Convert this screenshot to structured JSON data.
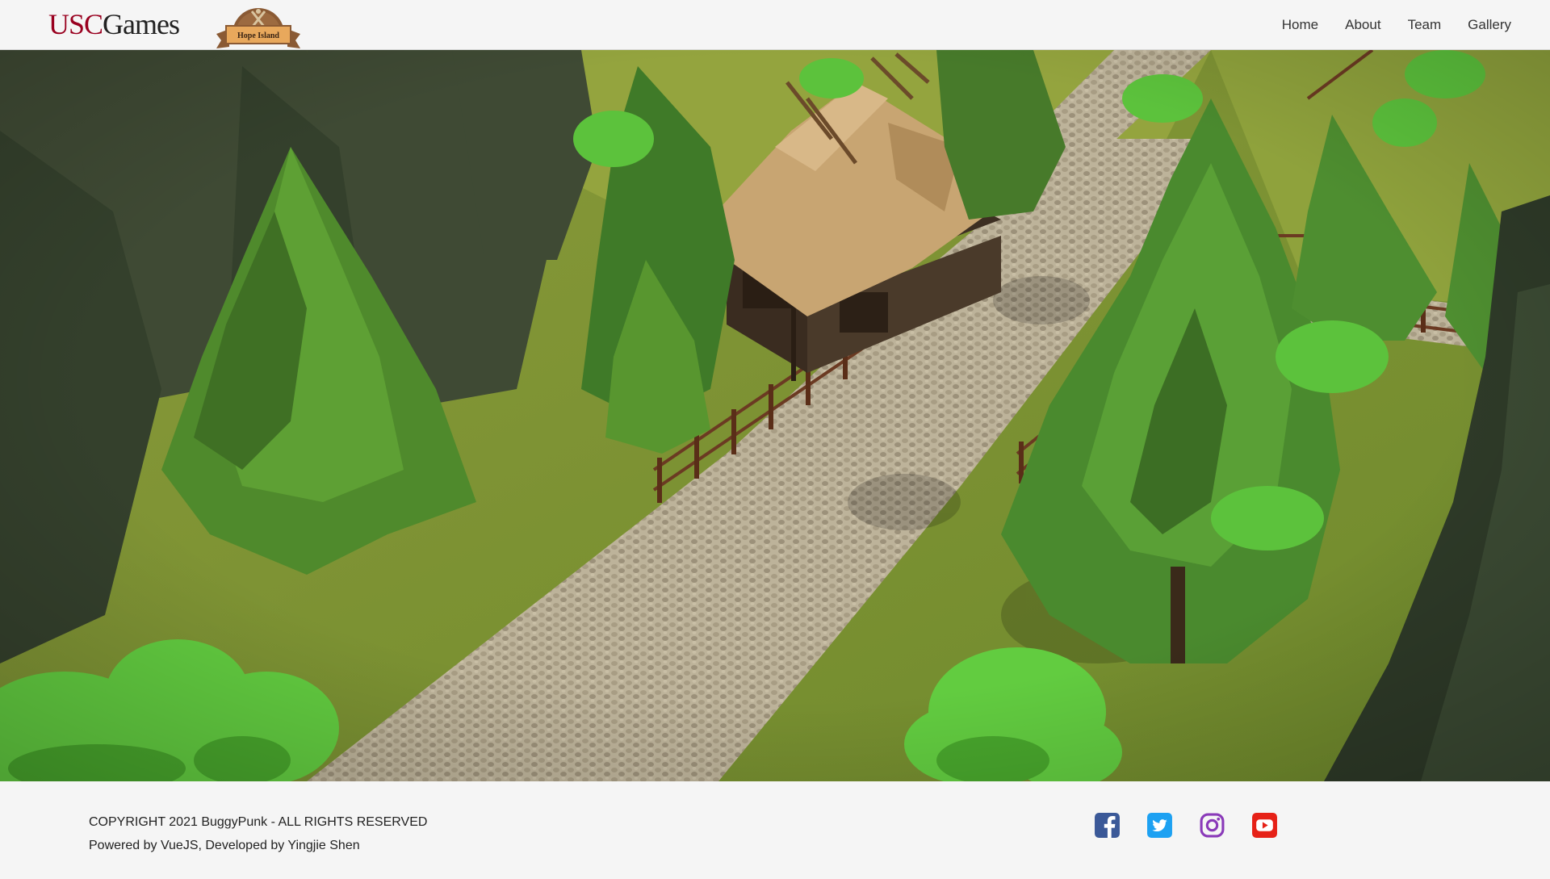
{
  "header": {
    "brand": {
      "usc": "USC",
      "games": "Games"
    },
    "game_logo_text": "Hope Island",
    "nav": {
      "home": "Home",
      "about": "About",
      "team": "Team",
      "gallery": "Gallery"
    }
  },
  "footer": {
    "copyright": "COPYRIGHT 2021 BuggyPunk - ALL RIGHTS RESERVED",
    "powered": "Powered by VueJS, Developed by Yingjie Shen",
    "socials": {
      "facebook": {
        "icon": "facebook-icon",
        "color": "#3b5998"
      },
      "twitter": {
        "icon": "twitter-icon",
        "color": "#1da1f2"
      },
      "instagram": {
        "icon": "instagram-icon",
        "color": "#8a3ab9"
      },
      "youtube": {
        "icon": "youtube-icon",
        "color": "#e62117"
      }
    }
  },
  "colors": {
    "brand_red": "#99001f",
    "grass": "#6f8a2c",
    "path": "#bdb39a"
  }
}
